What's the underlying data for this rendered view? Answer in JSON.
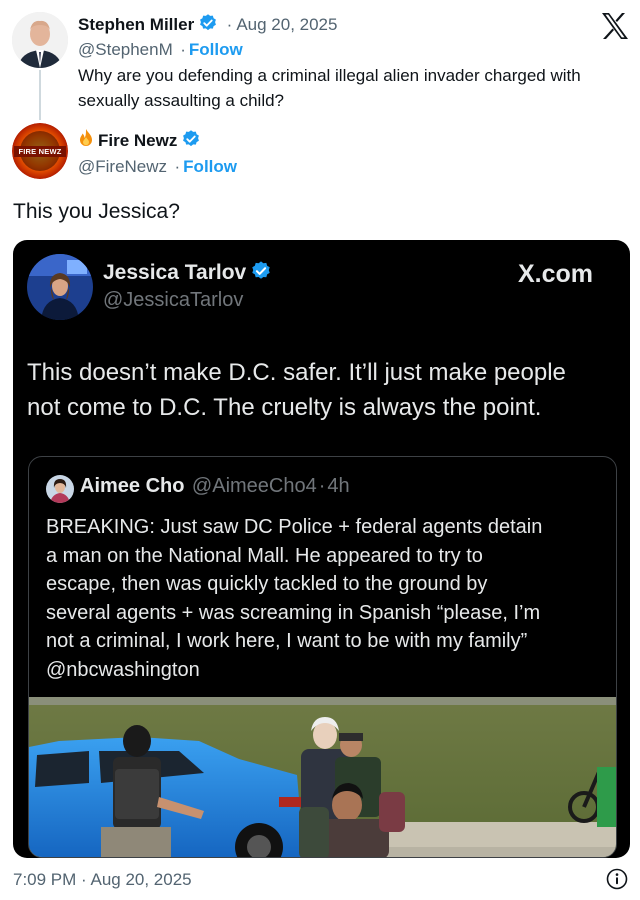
{
  "parent_tweet": {
    "display_name": "Stephen Miller",
    "handle": "@StephenM",
    "date": "Aug 20, 2025",
    "separator": "·",
    "follow_label": "Follow",
    "text": "Why are you defending a criminal illegal alien invader charged with sexually assaulting a child?"
  },
  "reply_tweet": {
    "display_name": "Fire Newz",
    "handle": "@FireNewz",
    "separator": "·",
    "follow_label": "Follow",
    "text": "This you Jessica?",
    "avatar_text": "FIRE NEWZ"
  },
  "embedded_tweet": {
    "display_name": "Jessica Tarlov",
    "handle": "@JessicaTarlov",
    "site_label": "X.com",
    "text_line1": "This doesn’t make D.C. safer. It’ll just make people",
    "text_line2": "not come to D.C. The cruelty is always the point.",
    "quoted": {
      "display_name": "Aimee Cho",
      "handle": "@AimeeCho4",
      "separator": "·",
      "time_ago": "4h",
      "lines": [
        "BREAKING: Just saw DC Police + federal agents detain",
        "a man on the National Mall. He appeared to try to",
        "escape, then was quickly tackled to the ground by",
        "several agents + was screaming in Spanish “please, I’m",
        "not a criminal, I work here, I want to be with my family”",
        "@nbcwashington"
      ]
    }
  },
  "footer": {
    "timestamp": "7:09 PM · Aug 20, 2025"
  },
  "colors": {
    "brand_blue": "#1d9bf0",
    "text_primary": "#0f1419",
    "text_secondary": "#536471",
    "card_bg": "#000000",
    "car_blue": "#1e88e5"
  },
  "icons": [
    "x-logo-icon",
    "verified-badge-icon",
    "fire-emoji-icon",
    "info-icon"
  ]
}
